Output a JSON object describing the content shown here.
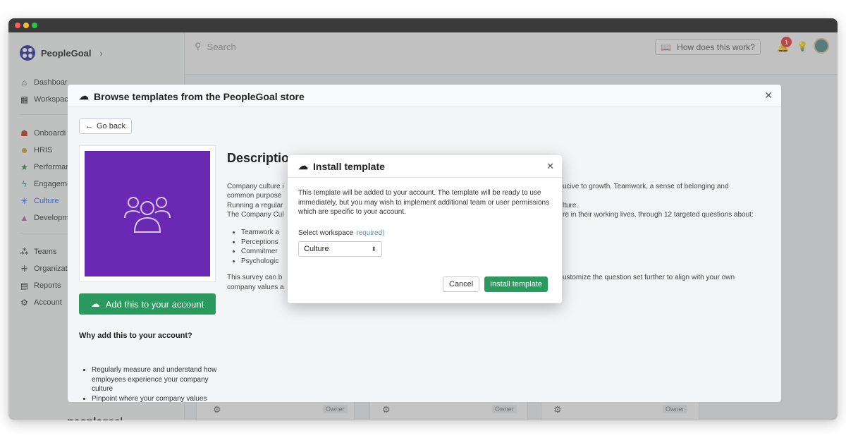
{
  "brand": {
    "name": "PeopleGoal",
    "chevron": "›"
  },
  "sidebar": {
    "items": [
      {
        "label": "Dashboar",
        "icon": "home-icon"
      },
      {
        "label": "Workspac",
        "icon": "grid-icon"
      },
      {
        "label": "Onboardi",
        "icon": "onboarding-icon"
      },
      {
        "label": "HRIS",
        "icon": "hris-icon"
      },
      {
        "label": "Performar",
        "icon": "star-icon"
      },
      {
        "label": "Engageme",
        "icon": "bolt-icon"
      },
      {
        "label": "Culture",
        "icon": "asterisk-icon"
      },
      {
        "label": "Developm",
        "icon": "graduation-icon"
      },
      {
        "label": "Teams",
        "icon": "teams-icon"
      },
      {
        "label": "Organizat",
        "icon": "org-icon"
      },
      {
        "label": "Reports",
        "icon": "reports-icon"
      },
      {
        "label": "Account",
        "icon": "gear-icon"
      }
    ],
    "footer_logo_a": "people",
    "footer_logo_b": "goal"
  },
  "topbar": {
    "search_placeholder": "Search",
    "how_label": "How does this work?",
    "notification_count": "1"
  },
  "background": {
    "owner_label": "Owner"
  },
  "store_modal": {
    "title": "Browse templates from the PeopleGoal store",
    "go_back": "Go back",
    "add_button": "Add this to your account",
    "why_title": "Why add this to your account?",
    "why_items": [
      "Regularly measure and understand how employees experience your company culture",
      "Pinpoint where your company values aren't being aligned with team members' actual working life"
    ],
    "description_title": "Description",
    "desc_lines": [
      "Company culture i",
      "common purpose",
      "Running a regular",
      "The Company Cul"
    ],
    "desc_right_lines": [
      "ucive to growth. Teamwork, a sense of belonging and",
      "",
      "lture.",
      "re in their working lives, through 12 targeted questions about:"
    ],
    "desc_list": [
      "Teamwork a",
      "Perceptions",
      "Commitmer",
      "Psychologic"
    ],
    "desc_tail_left": [
      "This survey can b",
      "company values a"
    ],
    "desc_tail_right": "ustomize the question set further to align with your own"
  },
  "install_modal": {
    "title": "Install template",
    "body": "This template will be added to your account. The template will be ready to use immediately, but you may wish to implement additional team or user permissions which are specific to your account.",
    "workspace_label": "Select workspace",
    "required_label": "required)",
    "workspace_value": "Culture",
    "cancel": "Cancel",
    "install": "Install template"
  },
  "colors": {
    "accent_green": "#2b9a5e",
    "template_purple": "#6a29b3",
    "active_blue": "#2563eb"
  }
}
